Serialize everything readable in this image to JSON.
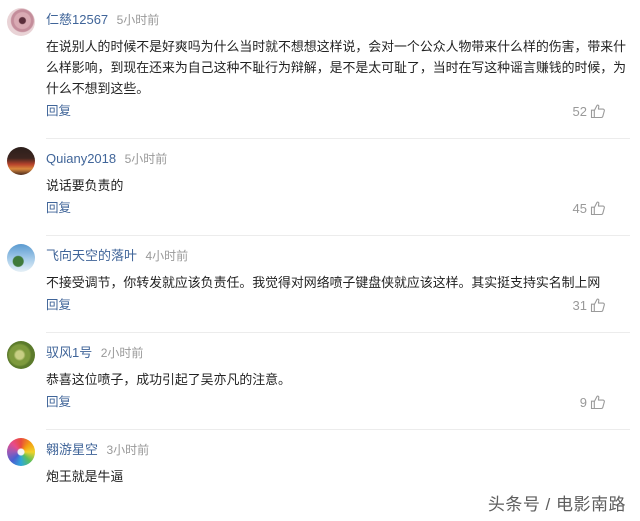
{
  "colors": {
    "accent": "#406599",
    "meta": "#999999",
    "text": "#222222",
    "divider": "#ececec"
  },
  "comments": [
    {
      "avatar": "pink-flower",
      "user": "仁慈12567",
      "time": "5小时前",
      "text": "在说别人的时候不是好爽吗为什么当时就不想想这样说，会对一个公众人物带来什么样的伤害，带来什么样影响，到现在还来为自己这种不耻行为辩解，是不是太可耻了，当时在写这种谣言赚钱的时候，为什么不想到这些。",
      "reply": "回复",
      "likes": "52"
    },
    {
      "avatar": "red-landscape",
      "user": "Quiany2018",
      "time": "5小时前",
      "text": "说话要负责的",
      "reply": "回复",
      "likes": "45"
    },
    {
      "avatar": "sky-tree",
      "user": "飞向天空的落叶",
      "time": "4小时前",
      "text": "不接受调节，你转发就应该负责任。我觉得对网络喷子键盘侠就应该这样。其实挺支持实名制上网",
      "reply": "回复",
      "likes": "31"
    },
    {
      "avatar": "green-cactus",
      "user": "驭风1号",
      "time": "2小时前",
      "text": "恭喜这位喷子，成功引起了吴亦凡的注意。",
      "reply": "回复",
      "likes": "9"
    },
    {
      "avatar": "color-wheel",
      "user": "翱游星空",
      "time": "3小时前",
      "text": "炮王就是牛逼"
    }
  ],
  "icons": {
    "like": "thumbs-up-icon"
  },
  "watermark": "头条号 / 电影南路"
}
